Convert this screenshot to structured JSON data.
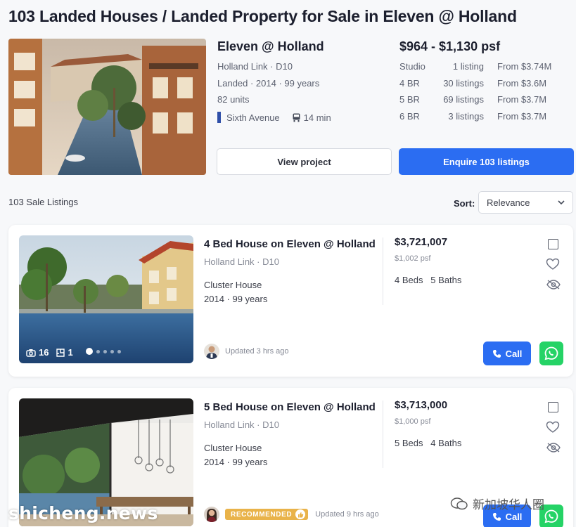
{
  "page": {
    "title": "103 Landed Houses / Landed Property for Sale in Eleven @ Holland"
  },
  "project": {
    "name": "Eleven @ Holland",
    "location": "Holland Link · D10",
    "details": "Landed · 2014 · 99 years",
    "units": "82 units",
    "mrt_station": "Sixth Avenue",
    "travel_time": "14 min",
    "price_range": "$964 - $1,130 psf",
    "unit_types": [
      {
        "type": "Studio",
        "count": "1 listing",
        "from": "From $3.74M"
      },
      {
        "type": "4 BR",
        "count": "30 listings",
        "from": "From $3.6M"
      },
      {
        "type": "5 BR",
        "count": "69 listings",
        "from": "From $3.7M"
      },
      {
        "type": "6 BR",
        "count": "3 listings",
        "from": "From $3.7M"
      }
    ],
    "view_button": "View project",
    "enquire_button": "Enquire 103 listings",
    "accent_color": "#2b6df2"
  },
  "results": {
    "count_label": "103 Sale Listings",
    "sort_label": "Sort:",
    "sort_value": "Relevance"
  },
  "listings": [
    {
      "title": "4 Bed House on Eleven @ Holland",
      "location": "Holland Link · D10",
      "property_type": "Cluster House",
      "tenure": "2014 · 99 years",
      "price": "$3,721,007",
      "psf": "$1,002 psf",
      "beds_baths": "4 Beds   5 Baths",
      "photo_count": "16",
      "floorplan_count": "1",
      "updated": "Updated 3 hrs ago",
      "call_label": "Call"
    },
    {
      "title": "5 Bed House on Eleven @ Holland",
      "location": "Holland Link · D10",
      "property_type": "Cluster House",
      "tenure": "2014 · 99 years",
      "price": "$3,713,000",
      "psf": "$1,000 psf",
      "beds_baths": "5 Beds   4 Baths",
      "badge": "RECOMMENDED",
      "updated": "Updated 9 hrs ago",
      "call_label": "Call"
    }
  ],
  "watermarks": {
    "left": "shicheng.news",
    "right": "新加坡华人圈"
  }
}
